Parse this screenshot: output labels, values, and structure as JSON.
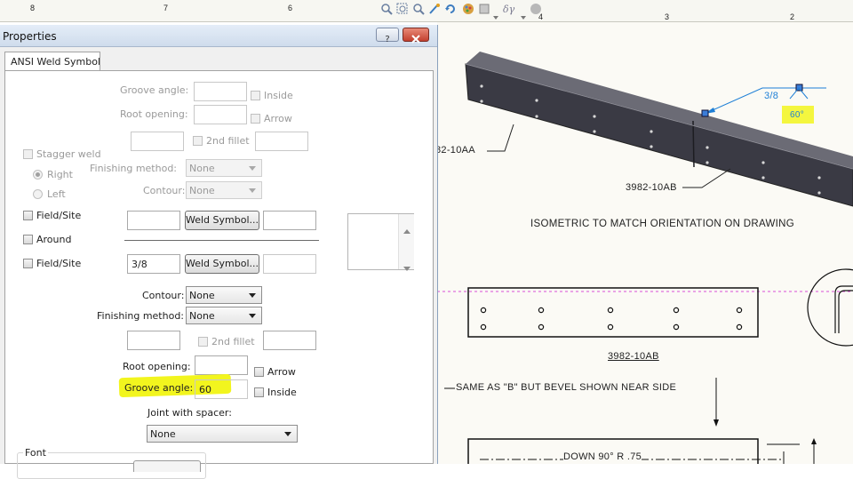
{
  "ruler": {
    "marks": [
      "8",
      "7",
      "6",
      "4",
      "3",
      "2"
    ]
  },
  "dialog": {
    "title": "Properties",
    "help_label": "?",
    "tab": "ANSI Weld Symbol",
    "top": {
      "groove_angle_label": "Groove angle:",
      "root_opening_label": "Root opening:",
      "inside_label": "Inside",
      "arrow_label": "Arrow",
      "second_fillet_label": "2nd fillet",
      "finishing_method_label": "Finishing method:",
      "finishing_method_value": "None",
      "contour_label": "Contour:",
      "contour_value": "None",
      "weld_symbol_button": "Weld Symbol..."
    },
    "stagger_weld_label": "Stagger weld",
    "right_label": "Right",
    "left_label": "Left",
    "field_site_label_1": "Field/Site",
    "around_label": "Around",
    "field_site_label_2": "Field/Site",
    "bottom": {
      "weld_size_value": "3/8",
      "weld_symbol_button": "Weld Symbol...",
      "contour_label": "Contour:",
      "contour_value": "None",
      "finishing_method_label": "Finishing method:",
      "finishing_method_value": "None",
      "second_fillet_label": "2nd fillet",
      "root_opening_label": "Root opening:",
      "arrow_label": "Arrow",
      "groove_angle_label": "Groove angle:",
      "groove_angle_value": "60",
      "inside_label": "Inside",
      "joint_with_spacer_label": "Joint with spacer:",
      "joint_with_spacer_value": "None"
    },
    "font_group_label": "Font"
  },
  "drawing": {
    "label_10aa": "82-10AA",
    "label_10ab": "3982-10AB",
    "weld_size": "3/8",
    "weld_angle": "60°",
    "isometric_note": "ISOMETRIC TO MATCH ORIENTATION ON DRAWING",
    "view_label": "3982-10AB",
    "same_as_note": "SAME AS \"B\" BUT BEVEL SHOWN NEAR SIDE",
    "down_note": "DOWN 90° R .75"
  },
  "colors": {
    "highlight": "#f2f51e",
    "dialog_bg": "#f0f0f0",
    "title_bar": "#dce8f5",
    "close_button": "#c84a3c",
    "leader_blue": "#1e7fd6",
    "sheet_bg": "#fbfaf5"
  }
}
